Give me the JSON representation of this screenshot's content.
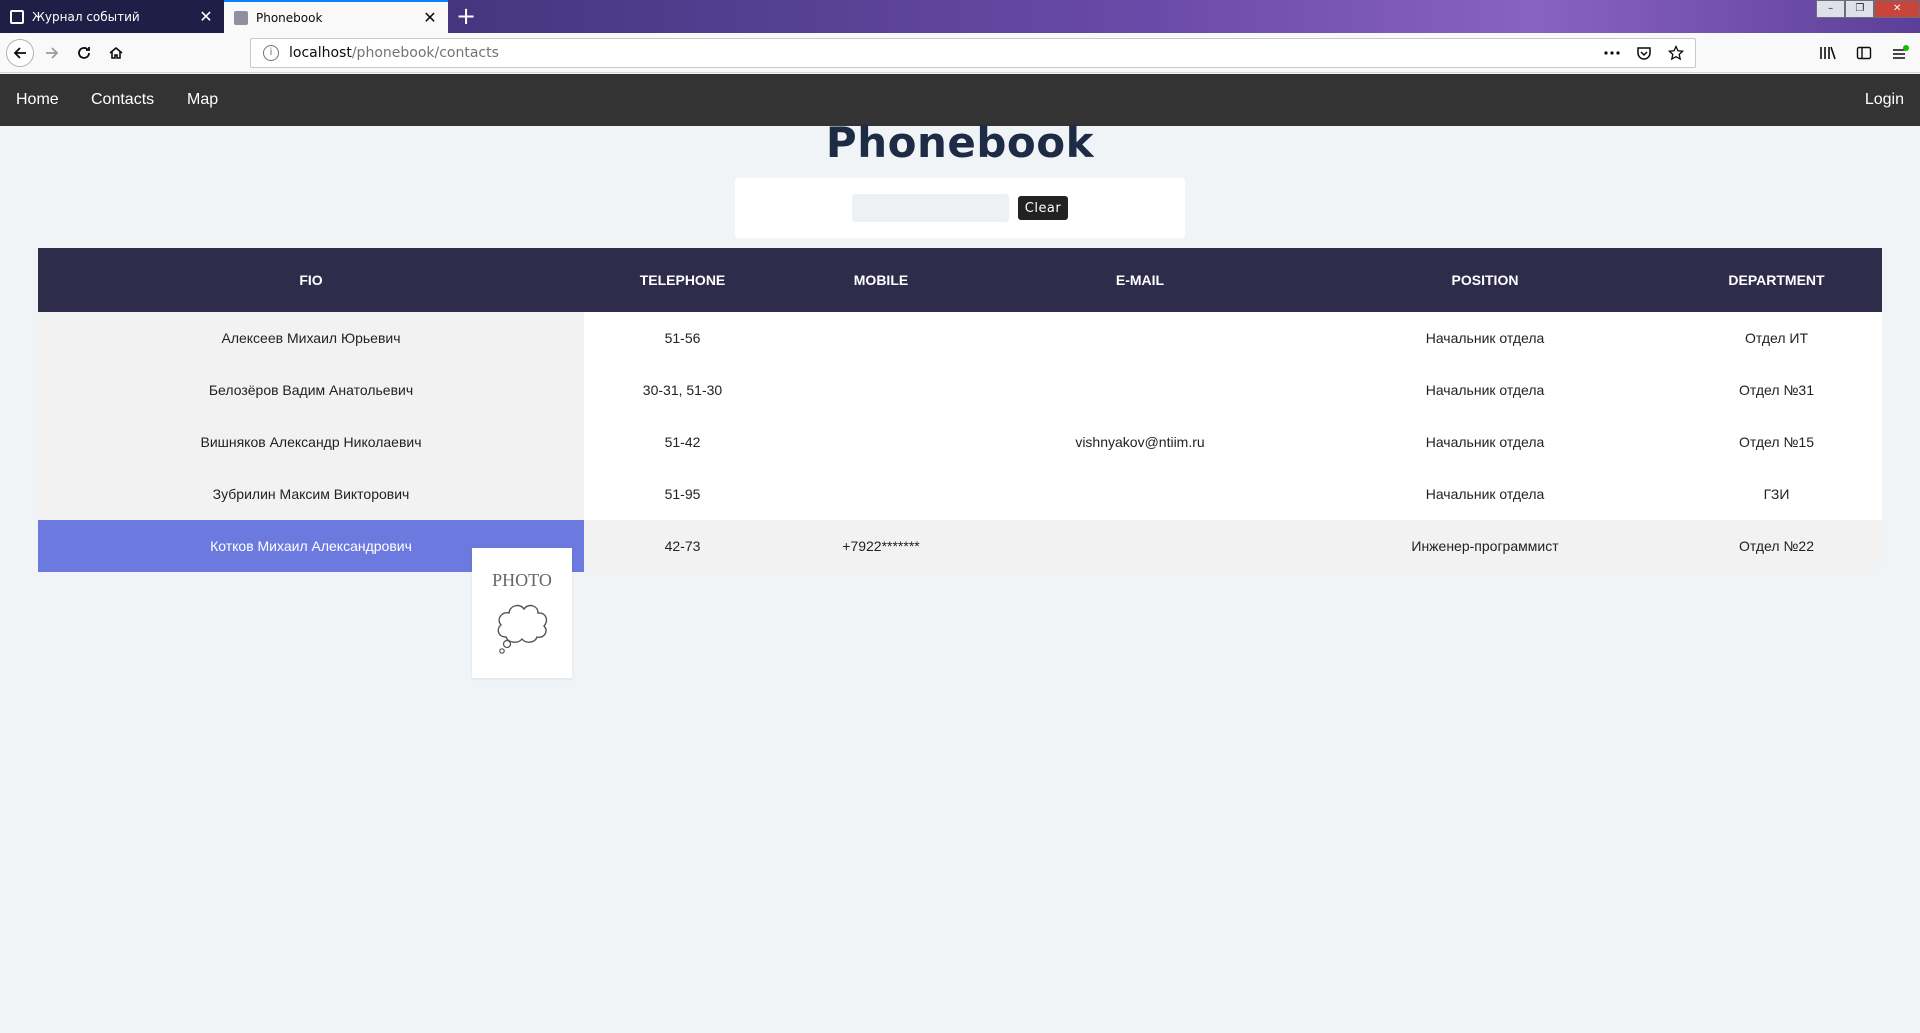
{
  "browser": {
    "tabs": [
      {
        "title": "Журнал событий",
        "active": false
      },
      {
        "title": "Phonebook",
        "active": true
      }
    ],
    "url": {
      "host": "localhost",
      "path": "/phonebook/contacts"
    },
    "icons": [
      "back-icon",
      "forward-icon",
      "reload-icon",
      "home-icon",
      "page-info-icon",
      "more-icon",
      "pocket-icon",
      "bookmark-star-icon",
      "library-icon",
      "sidebar-icon",
      "menu-icon"
    ]
  },
  "nav": {
    "home": "Home",
    "contacts": "Contacts",
    "map": "Map",
    "login": "Login"
  },
  "page": {
    "title": "Phonebook"
  },
  "search": {
    "value": "",
    "placeholder": "",
    "clear_label": "Clear"
  },
  "table": {
    "columns": [
      "FIO",
      "TELEPHONE",
      "MOBILE",
      "E-MAIL",
      "POSITION",
      "DEPARTMENT"
    ],
    "rows": [
      {
        "fio": "Алексеев Михаил Юрьевич",
        "telephone": "51-56",
        "mobile": "",
        "email": "",
        "position": "Начальник отдела",
        "department": "Отдел ИТ"
      },
      {
        "fio": "Белозёров Вадим Анатольевич",
        "telephone": "30-31, 51-30",
        "mobile": "",
        "email": "",
        "position": "Начальник отдела",
        "department": "Отдел №31"
      },
      {
        "fio": "Вишняков Александр Николаевич",
        "telephone": "51-42",
        "mobile": "",
        "email": "vishnyakov@ntiim.ru",
        "position": "Начальник отдела",
        "department": "Отдел №15"
      },
      {
        "fio": "Зубрилин Максим Викторович",
        "telephone": "51-95",
        "mobile": "",
        "email": "",
        "position": "Начальник отдела",
        "department": "ГЗИ"
      },
      {
        "fio": "Котков Михаил Александрович",
        "telephone": "42-73",
        "mobile": "+7922*******",
        "email": "",
        "position": "Инженер-программист",
        "department": "Отдел №22"
      }
    ],
    "selected_row": 4
  },
  "photo": {
    "label": "PHOTO",
    "icon": "thought-cloud-icon"
  },
  "colors": {
    "nav_bg": "#333333",
    "header_bg": "#2e2c4a",
    "selected_fio_bg": "#6c7ae0",
    "title_color": "#1d2b44",
    "tab_accent": "#0a84ff"
  }
}
